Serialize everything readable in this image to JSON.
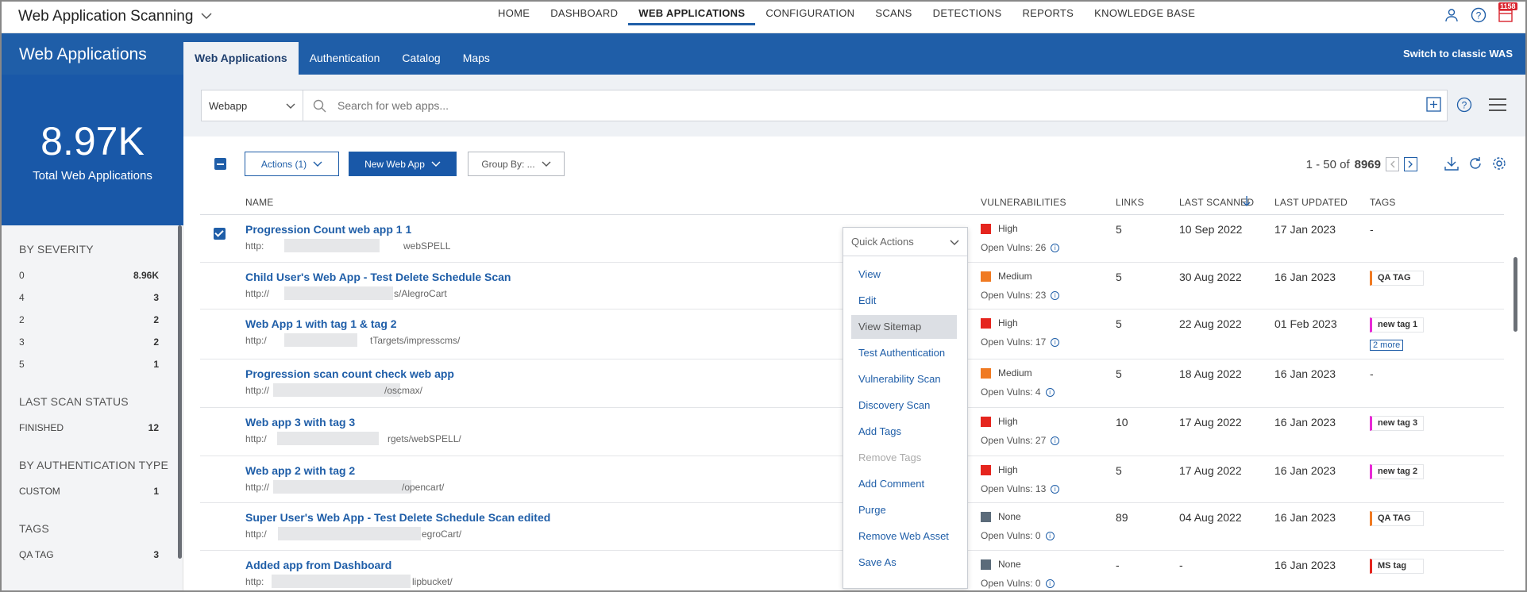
{
  "app": {
    "title": "Web Application Scanning"
  },
  "nav": {
    "items": [
      "HOME",
      "DASHBOARD",
      "WEB APPLICATIONS",
      "CONFIGURATION",
      "SCANS",
      "DETECTIONS",
      "REPORTS",
      "KNOWLEDGE BASE"
    ],
    "active": "WEB APPLICATIONS"
  },
  "notifications": {
    "count": "1158"
  },
  "left": {
    "title": "Web Applications",
    "kpi_value": "8.97K",
    "kpi_label": "Total Web Applications",
    "severity_title": "BY SEVERITY",
    "severity": [
      {
        "label": "0",
        "value": "8.96K"
      },
      {
        "label": "4",
        "value": "3"
      },
      {
        "label": "2",
        "value": "2"
      },
      {
        "label": "3",
        "value": "2"
      },
      {
        "label": "5",
        "value": "1"
      }
    ],
    "scan_status_title": "LAST SCAN STATUS",
    "scan_status": [
      {
        "label": "FINISHED",
        "value": "12"
      }
    ],
    "auth_title": "BY AUTHENTICATION TYPE",
    "auth": [
      {
        "label": "CUSTOM",
        "value": "1"
      }
    ],
    "tags_title": "TAGS",
    "tags": [
      {
        "label": "QA TAG",
        "value": "3"
      }
    ]
  },
  "subtabs": [
    "Web Applications",
    "Authentication",
    "Catalog",
    "Maps"
  ],
  "switch_link": "Switch to classic WAS",
  "search": {
    "filter": "Webapp",
    "placeholder": "Search for web apps..."
  },
  "toolbar": {
    "actions": "Actions (1)",
    "new_web_app": "New Web App",
    "group_by": "Group By: ..."
  },
  "pager": {
    "range": "1 - 50 of",
    "total": "8969"
  },
  "columns": {
    "name": "NAME",
    "vulnerabilities": "VULNERABILITIES",
    "links": "LINKS",
    "last_scanned": "LAST SCANNED",
    "last_updated": "LAST UPDATED",
    "tags": "TAGS"
  },
  "rows": [
    {
      "name": "Progression Count web app 1 1",
      "url_start": "http:",
      "url_end": "webSPELL",
      "severity": "High",
      "sev_color": "#e5251e",
      "vulns": "Open Vulns: 26",
      "links": "5",
      "last_scanned": "10 Sep 2022",
      "last_updated": "17 Jan 2023",
      "tag": "-",
      "tag_color": "",
      "more": ""
    },
    {
      "name": "Child User's Web App - Test Delete Schedule Scan",
      "url_start": "http://",
      "url_end": "s/AlegroCart",
      "severity": "Medium",
      "sev_color": "#f07a22",
      "vulns": "Open Vulns: 23",
      "links": "5",
      "last_scanned": "30 Aug 2022",
      "last_updated": "16 Jan 2023",
      "tag": "QA TAG",
      "tag_color": "#f07a22",
      "more": ""
    },
    {
      "name": "Web App 1 with tag 1 & tag 2",
      "url_start": "http:/",
      "url_end": "tTargets/impresscms/",
      "severity": "High",
      "sev_color": "#e5251e",
      "vulns": "Open Vulns: 17",
      "links": "5",
      "last_scanned": "22 Aug 2022",
      "last_updated": "01 Feb 2023",
      "tag": "new tag 1",
      "tag_color": "#e829d6",
      "more": "2 more"
    },
    {
      "name": "Progression scan count check web app",
      "url_start": "http://",
      "url_end": "/oscmax/",
      "severity": "Medium",
      "sev_color": "#f07a22",
      "vulns": "Open Vulns: 4",
      "links": "5",
      "last_scanned": "18 Aug 2022",
      "last_updated": "16 Jan 2023",
      "tag": "-",
      "tag_color": "",
      "more": ""
    },
    {
      "name": "Web app 3 with tag 3",
      "url_start": "http:/",
      "url_end": "rgets/webSPELL/",
      "severity": "High",
      "sev_color": "#e5251e",
      "vulns": "Open Vulns: 27",
      "links": "10",
      "last_scanned": "17 Aug 2022",
      "last_updated": "16 Jan 2023",
      "tag": "new tag 3",
      "tag_color": "#e829d6",
      "more": ""
    },
    {
      "name": "Web app 2 with tag 2",
      "url_start": "http://",
      "url_end": "/opencart/",
      "severity": "High",
      "sev_color": "#e5251e",
      "vulns": "Open Vulns: 13",
      "links": "5",
      "last_scanned": "17 Aug 2022",
      "last_updated": "16 Jan 2023",
      "tag": "new tag 2",
      "tag_color": "#e829d6",
      "more": ""
    },
    {
      "name": "Super User's Web App - Test Delete Schedule Scan edited",
      "url_start": "http:/",
      "url_end": "egroCart/",
      "severity": "None",
      "sev_color": "#5b6b7a",
      "vulns": "Open Vulns: 0",
      "links": "89",
      "last_scanned": "04 Aug 2022",
      "last_updated": "16 Jan 2023",
      "tag": "QA TAG",
      "tag_color": "#f07a22",
      "more": ""
    },
    {
      "name": "Added app from Dashboard",
      "url_start": "http:",
      "url_end": "lipbucket/",
      "severity": "None",
      "sev_color": "#5b6b7a",
      "vulns": "Open Vulns: 0",
      "links": "-",
      "last_scanned": "-",
      "last_updated": "16 Jan 2023",
      "tag": "MS tag",
      "tag_color": "#e5251e",
      "more": ""
    }
  ],
  "quick_actions": {
    "label": "Quick Actions",
    "items": [
      "View",
      "Edit",
      "View Sitemap",
      "Test Authentication",
      "Vulnerability Scan",
      "Discovery Scan",
      "Add Tags",
      "Remove Tags",
      "Add Comment",
      "Purge",
      "Remove Web Asset",
      "Save As"
    ],
    "hovered": "View Sitemap",
    "disabled": "Remove Tags"
  },
  "icons": {
    "user": "user-icon",
    "help": "help-icon",
    "notifications": "calendar-icon",
    "search": "search-icon",
    "add": "add-icon",
    "download": "download-icon",
    "refresh": "refresh-icon",
    "settings": "gear-icon",
    "menu": "hamburger-icon",
    "sort": "sort-down-icon"
  },
  "colors": {
    "brand": "#1f5ea8",
    "high": "#e5251e",
    "medium": "#f07a22",
    "none": "#5b6b7a",
    "tag_pink": "#e829d6"
  }
}
